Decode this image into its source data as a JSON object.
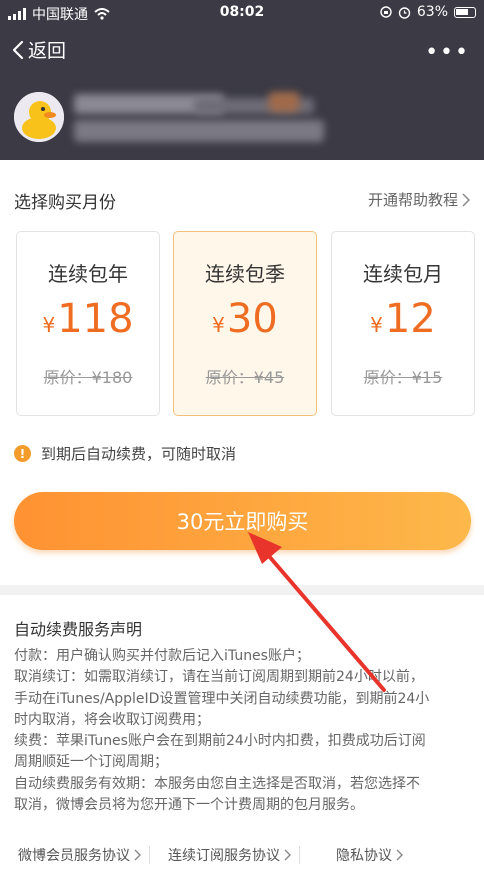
{
  "status_bar": {
    "carrier": "中国联通",
    "time": "08:02",
    "battery": "63%",
    "icons": [
      "signal-icon",
      "wifi-icon",
      "lock-rotation-icon",
      "alarm-icon",
      "battery-icon"
    ]
  },
  "nav": {
    "back_label": "返回",
    "more_label": "•••"
  },
  "purchase": {
    "section_title": "选择购买月份",
    "help_link": "开通帮助教程",
    "plans": [
      {
        "name": "连续包年",
        "currency": "¥",
        "price": "118",
        "original": "原价：¥180",
        "selected": false
      },
      {
        "name": "连续包季",
        "currency": "¥",
        "price": "30",
        "original": "原价：¥45",
        "selected": true
      },
      {
        "name": "连续包月",
        "currency": "¥",
        "price": "12",
        "original": "原价：¥15",
        "selected": false
      }
    ],
    "notice_icon": "!",
    "notice": "到期后自动续费，可随时取消",
    "buy_button": "30元立即购买"
  },
  "terms": {
    "title": "自动续费服务声明",
    "lines": [
      "付款：用户确认购买并付款后记入iTunes账户；",
      "取消续订：如需取消续订，请在当前订阅周期到期前24小时以前，",
      "手动在iTunes/AppleID设置管理中关闭自动续费功能，到期前24小",
      "时内取消，将会收取订阅费用；",
      "续费：苹果iTunes账户会在到期前24小时内扣费，扣费成功后订阅",
      "周期顺延一个订阅周期；",
      "自动续费服务有效期：本服务由您自主选择是否取消，若您选择不",
      "取消，微博会员将为您开通下一个计费周期的包月服务。"
    ]
  },
  "footer": {
    "links": [
      "微博会员服务协议",
      "连续订阅服务协议",
      "隐私协议"
    ]
  },
  "colors": {
    "header_bg": "#3b3a45",
    "accent_orange": "#ef6d22",
    "button_gradient_start": "#ff9232",
    "button_gradient_end": "#fdb84a",
    "annotation_red": "#e8342a"
  }
}
